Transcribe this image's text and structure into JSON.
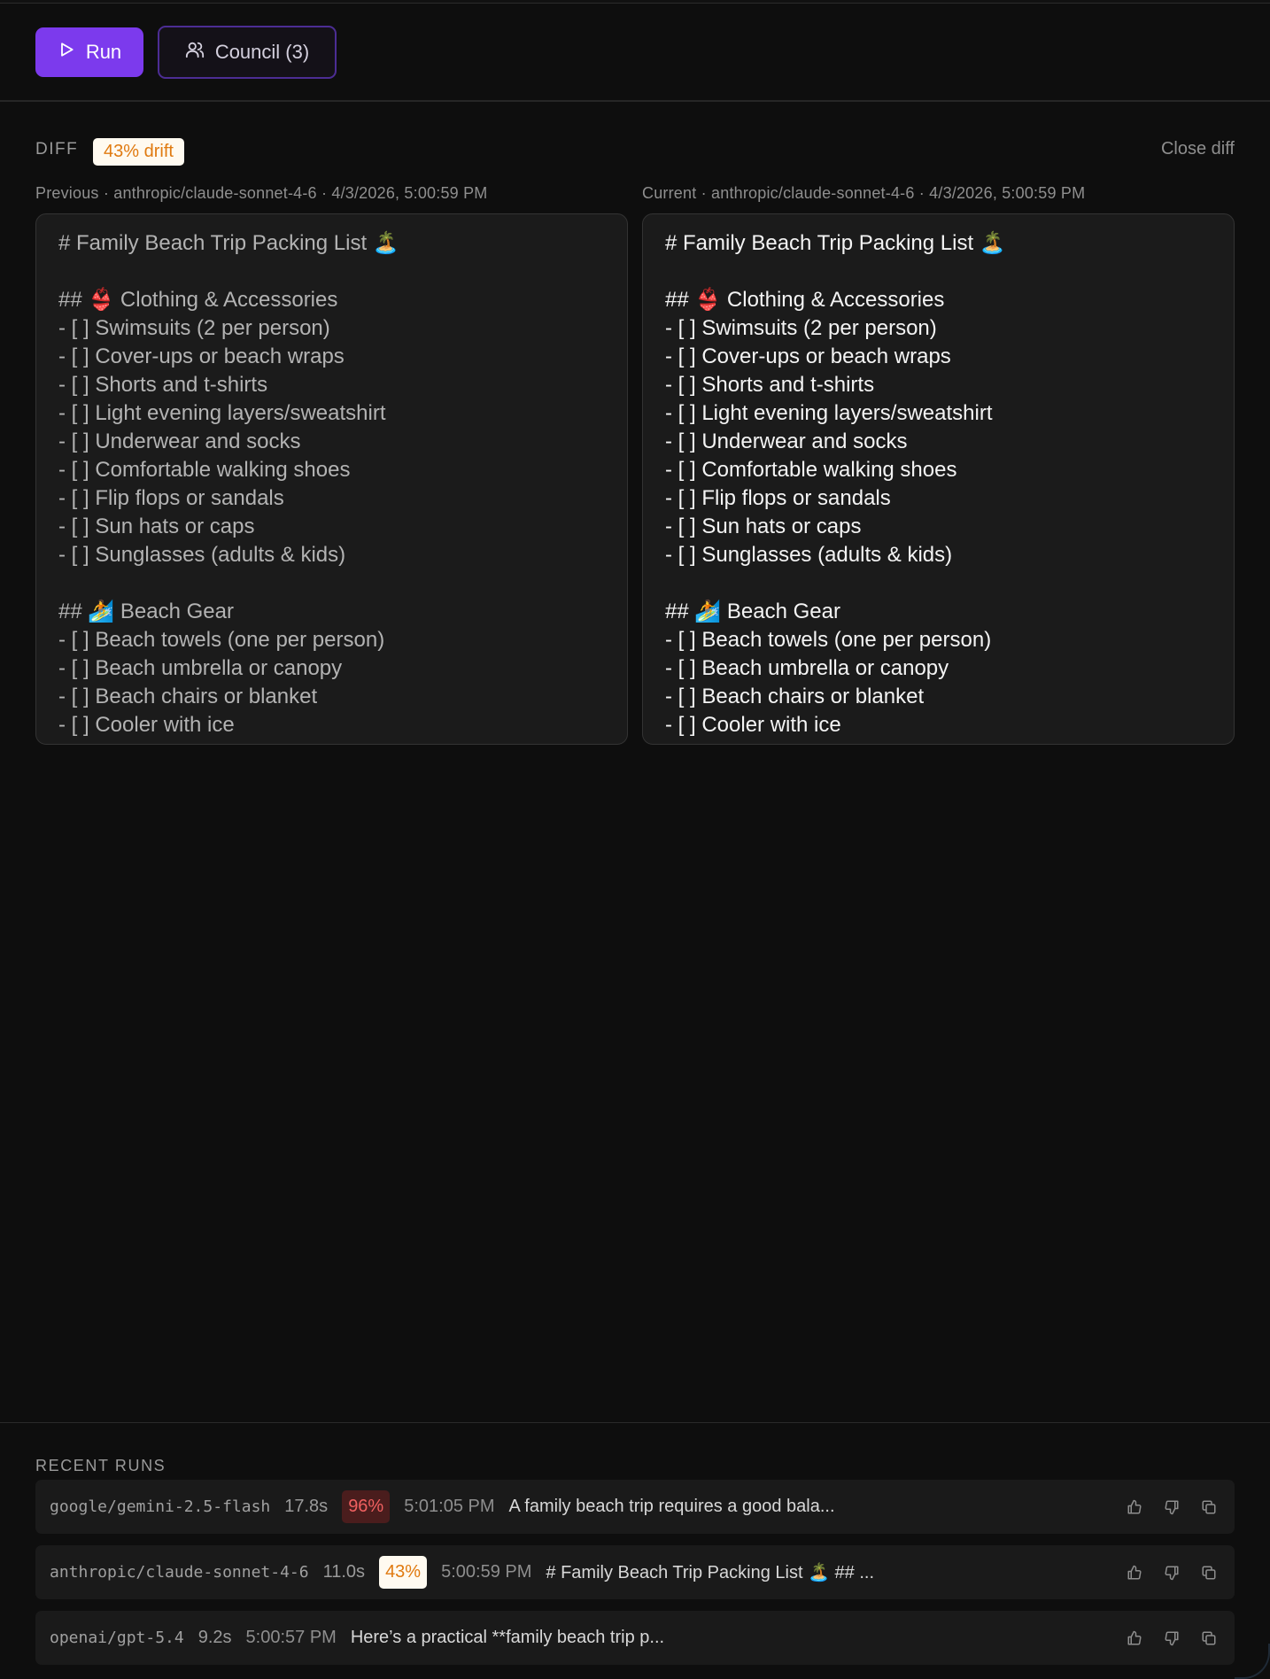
{
  "toolbar": {
    "run_label": "Run",
    "council_label": "Council (3)"
  },
  "diff": {
    "label": "DIFF",
    "drift": "43% drift",
    "close_label": "Close diff",
    "previous": {
      "meta": "Previous · anthropic/claude-sonnet-4-6 · 4/3/2026, 5:00:59 PM",
      "lines": [
        "# Family Beach Trip Packing List 🏝️",
        "",
        "## 👙 Clothing & Accessories",
        "- [ ] Swimsuits (2 per person)",
        "- [ ] Cover-ups or beach wraps",
        "- [ ] Shorts and t-shirts",
        "- [ ] Light evening layers/sweatshirt",
        "- [ ] Underwear and socks",
        "- [ ] Comfortable walking shoes",
        "- [ ] Flip flops or sandals",
        "- [ ] Sun hats or caps",
        "- [ ] Sunglasses (adults & kids)",
        "",
        "## 🏄 Beach Gear",
        "- [ ] Beach towels (one per person)",
        "- [ ] Beach umbrella or canopy",
        "- [ ] Beach chairs or blanket",
        "- [ ] Cooler with ice"
      ]
    },
    "current": {
      "meta": "Current · anthropic/claude-sonnet-4-6 · 4/3/2026, 5:00:59 PM",
      "lines": [
        "# Family Beach Trip Packing List 🏝️",
        "",
        "## 👙 Clothing & Accessories",
        "- [ ] Swimsuits (2 per person)",
        "- [ ] Cover-ups or beach wraps",
        "- [ ] Shorts and t-shirts",
        "- [ ] Light evening layers/sweatshirt",
        "- [ ] Underwear and socks",
        "- [ ] Comfortable walking shoes",
        "- [ ] Flip flops or sandals",
        "- [ ] Sun hats or caps",
        "- [ ] Sunglasses (adults & kids)",
        "",
        "## 🏄 Beach Gear",
        "- [ ] Beach towels (one per person)",
        "- [ ] Beach umbrella or canopy",
        "- [ ] Beach chairs or blanket",
        "- [ ] Cooler with ice"
      ]
    }
  },
  "recent_runs": {
    "title": "RECENT RUNS",
    "rows": [
      {
        "model": "google/gemini-2.5-flash",
        "duration": "17.8s",
        "drift": "96%",
        "time": "5:01:05 PM",
        "preview": "A family beach trip requires a good bala..."
      },
      {
        "model": "anthropic/claude-sonnet-4-6",
        "duration": "11.0s",
        "drift": "43%",
        "time": "5:00:59 PM",
        "preview": "# Family Beach Trip Packing List 🏝️ ## ..."
      },
      {
        "model": "openai/gpt-5.4",
        "duration": "9.2s",
        "drift": "",
        "time": "5:00:57 PM",
        "preview": "Here’s a practical **family beach trip p..."
      }
    ]
  },
  "colors": {
    "accent": "#7c3aed",
    "drift_orange": "#e07a10",
    "drift_red": "#f06060",
    "background": "#0e0e0e"
  },
  "icons": [
    "play-icon",
    "users-icon",
    "thumbs-up-icon",
    "thumbs-down-icon",
    "copy-icon"
  ]
}
